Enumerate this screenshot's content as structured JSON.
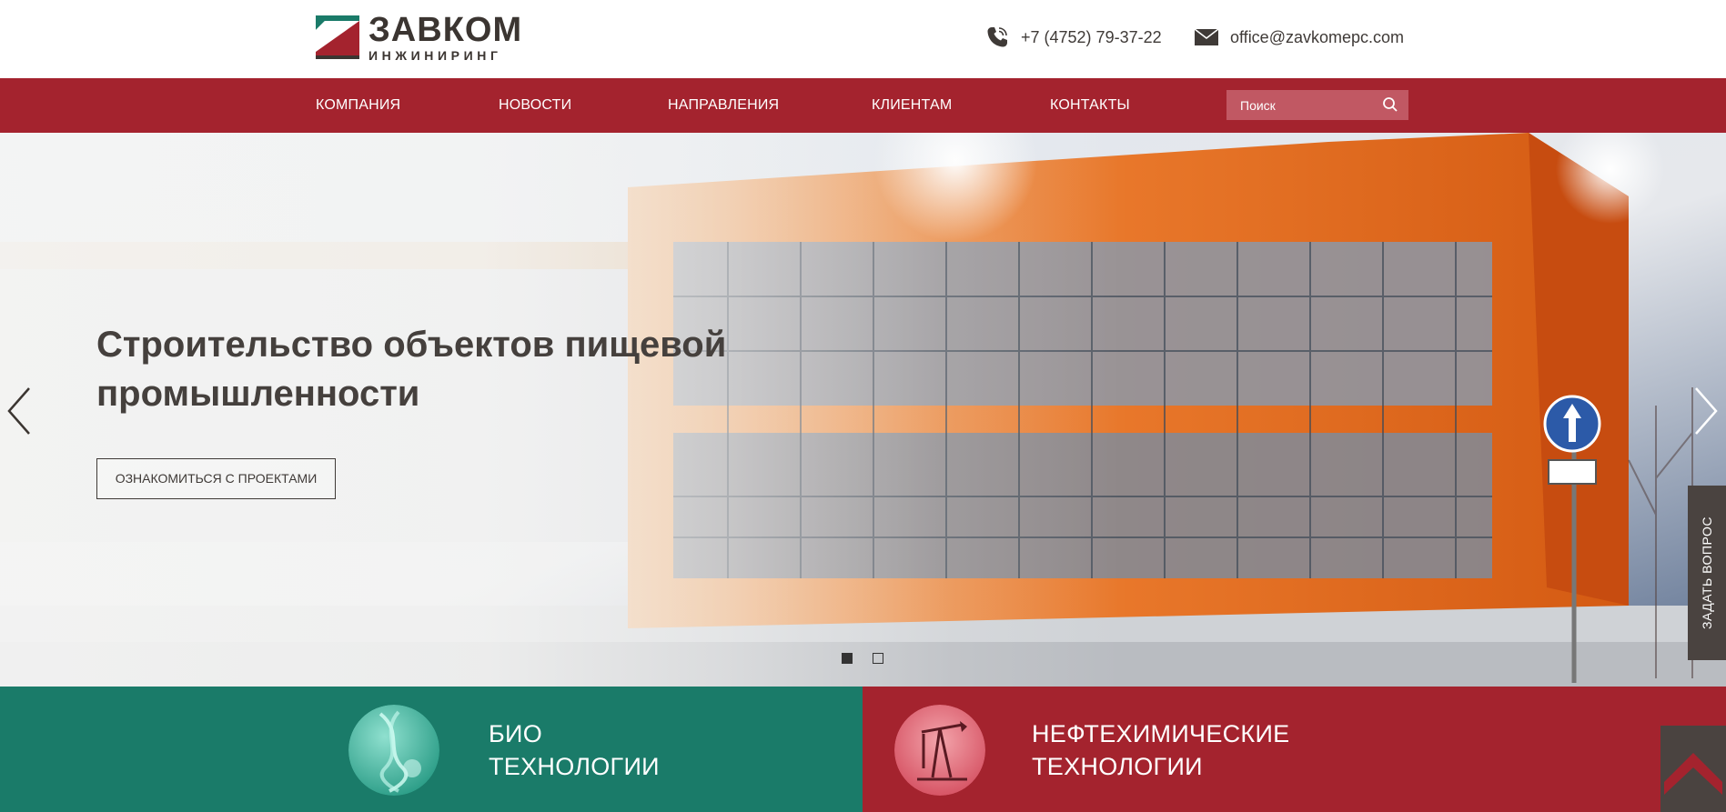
{
  "brand": {
    "name": "ЗАВКОМ",
    "subtitle": "ИНЖИНИРИНГ",
    "colors": {
      "red": "#a4232e",
      "green": "#1a7b69",
      "dark": "#3b3531"
    }
  },
  "header": {
    "phone": "+7 (4752) 79-37-22",
    "email": "office@zavkomepc.com",
    "phone_icon": "phone-icon",
    "email_icon": "envelope-icon"
  },
  "nav": {
    "items": [
      {
        "label": "КОМПАНИЯ"
      },
      {
        "label": "НОВОСТИ"
      },
      {
        "label": "НАПРАВЛЕНИЯ"
      },
      {
        "label": "КЛИЕНТАМ"
      },
      {
        "label": "КОНТАКТЫ"
      }
    ],
    "search": {
      "placeholder": "Поиск",
      "icon": "search-icon"
    }
  },
  "hero": {
    "title": "Строительство объектов пищевой промышленности",
    "button_label": "ОЗНАКОМИТЬСЯ С ПРОЕКТАМИ",
    "slides_total": 2,
    "active_slide": 1,
    "ask_label": "ЗАДАТЬ ВОПРОС"
  },
  "tiles": [
    {
      "line1": "БИО",
      "line2": "ТЕХНОЛОГИИ",
      "icon": "dna-icon"
    },
    {
      "line1": "НЕФТЕХИМИЧЕСКИЕ",
      "line2": "ТЕХНОЛОГИИ",
      "icon": "oil-pump-icon"
    }
  ]
}
